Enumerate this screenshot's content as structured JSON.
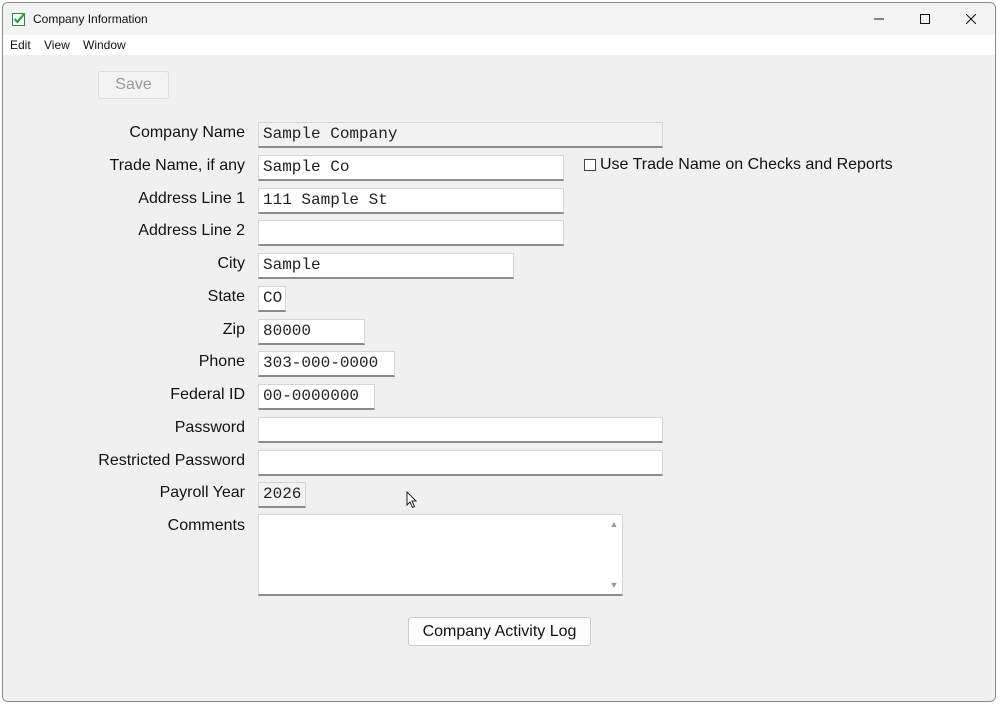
{
  "window": {
    "title": "Company Information"
  },
  "menu": {
    "items": [
      "Edit",
      "View",
      "Window"
    ]
  },
  "toolbar": {
    "save_label": "Save"
  },
  "form": {
    "company_name": {
      "label": "Company Name",
      "value": "Sample Company"
    },
    "trade_name": {
      "label": "Trade Name, if any",
      "value": "Sample Co"
    },
    "use_trade_name": {
      "label": "Use Trade Name on Checks and Reports",
      "checked": false
    },
    "address1": {
      "label": "Address Line 1",
      "value": "111 Sample St"
    },
    "address2": {
      "label": "Address Line 2",
      "value": ""
    },
    "city": {
      "label": "City",
      "value": "Sample"
    },
    "state": {
      "label": "State",
      "value": "CO"
    },
    "zip": {
      "label": "Zip",
      "value": "80000"
    },
    "phone": {
      "label": "Phone",
      "value": "303-000-0000"
    },
    "federal_id": {
      "label": "Federal ID",
      "value": "00-0000000"
    },
    "password": {
      "label": "Password",
      "value": ""
    },
    "restricted_password": {
      "label": "Restricted Password",
      "value": ""
    },
    "payroll_year": {
      "label": "Payroll Year",
      "value": "2026"
    },
    "comments": {
      "label": "Comments",
      "value": ""
    }
  },
  "activity_log_button": {
    "label": "Company Activity Log"
  },
  "colors": {
    "window_bg": "#f0f0f0",
    "field_bg": "#ffffff",
    "icon_green": "#2ea043"
  }
}
